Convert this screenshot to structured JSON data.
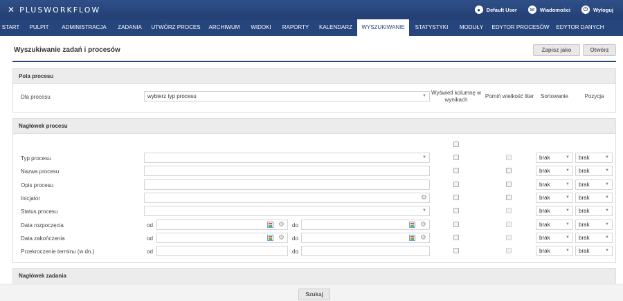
{
  "app": {
    "logo": "PLUSWORKFLOW"
  },
  "user": {
    "name": "Default User",
    "messages": "Wiadomości",
    "logout": "Wyloguj"
  },
  "menu": [
    {
      "label": "START"
    },
    {
      "label": "PULPIT"
    },
    {
      "label": "ADMINISTRACJA"
    },
    {
      "label": "ZADANIA"
    },
    {
      "label": "UTWÓRZ PROCES"
    },
    {
      "label": "ARCHIWUM"
    },
    {
      "label": "WIDOKI"
    },
    {
      "label": "RAPORTY"
    },
    {
      "label": "KALENDARZ"
    },
    {
      "label": "WYSZUKIWANIE"
    },
    {
      "label": "STATYSTYKI"
    },
    {
      "label": "MODUŁY"
    },
    {
      "label": "EDYTOR PROCESÓW"
    },
    {
      "label": "EDYTOR DANYCH"
    }
  ],
  "page": {
    "title": "Wyszukiwanie zadań i procesów",
    "save_as": "Zapisz jako",
    "open": "Otwórz"
  },
  "process_fields": {
    "header": "Pola procesu",
    "for_process_label": "Dla procesu",
    "process_select": "wybierz typ procesu",
    "col_show": "Wyświetl kolumnę w wynikach",
    "col_ignore_case": "Pomiń wielkość liter",
    "col_sort": "Sortowanie",
    "col_position": "Pozycja"
  },
  "process_header": {
    "header": "Nagłówek procesu",
    "rows": [
      {
        "label": "Typ procesu",
        "sort": "brak",
        "position": "brak"
      },
      {
        "label": "Nazwa procesu",
        "sort": "brak",
        "position": "brak"
      },
      {
        "label": "Opis procesu",
        "sort": "brak",
        "position": "brak"
      },
      {
        "label": "Inicjator",
        "sort": "brak",
        "position": "brak"
      },
      {
        "label": "Status procesu",
        "sort": "brak",
        "position": "brak"
      },
      {
        "label": "Data rozpoczęcia",
        "sort": "brak",
        "position": "brak"
      },
      {
        "label": "Data zakończenia",
        "sort": "brak",
        "position": "brak"
      },
      {
        "label": "Przekroczenie terminu (w dn.)",
        "sort": "brak",
        "position": "brak"
      }
    ],
    "from": "od",
    "to": "do"
  },
  "task_header": {
    "header": "Nagłówek zadania"
  },
  "search_button": "Szukaj",
  "colors": {
    "nav": "#26457d",
    "topbar": "#2f4f88",
    "active_tab_text": "#26457d"
  }
}
